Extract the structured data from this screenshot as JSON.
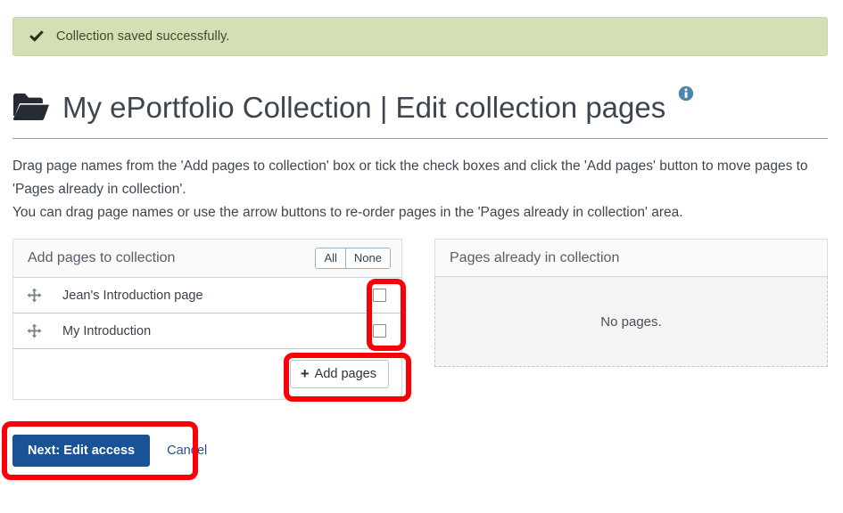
{
  "banner": {
    "icon": "check-icon",
    "message": "Collection saved successfully."
  },
  "header": {
    "icon": "folder-open-icon",
    "title": "My ePortfolio Collection | Edit collection pages",
    "info_icon": "info-circle-icon"
  },
  "instructions": {
    "line1": "Drag page names from the 'Add pages to collection' box or tick the check boxes and click the 'Add pages' button to move pages to 'Pages already in collection'.",
    "line2": "You can drag page names or use the arrow buttons to re-order pages in the 'Pages already in collection' area."
  },
  "add_panel": {
    "heading": "Add pages to collection",
    "select_all_label": "All",
    "select_none_label": "None",
    "rows": [
      {
        "handle_icon": "move-arrows-icon",
        "name": "Jean's Introduction page",
        "checked": false
      },
      {
        "handle_icon": "move-arrows-icon",
        "name": "My Introduction",
        "checked": false
      }
    ],
    "add_button": {
      "plus": "+",
      "label": "Add pages"
    }
  },
  "collection_panel": {
    "heading": "Pages already in collection",
    "empty_text": "No pages."
  },
  "actions": {
    "primary_label": "Next: Edit access",
    "cancel_label": "Cancel"
  },
  "colors": {
    "banner_bg": "#d3e0b5",
    "primary_button": "#1a5296",
    "link": "#1f4f9e",
    "highlight": "#fb0007",
    "info_icon": "#4a87ad",
    "title_rule": "#8ba6bd"
  },
  "highlights": [
    {
      "name": "checkbox-column-highlight"
    },
    {
      "name": "add-pages-button-highlight"
    },
    {
      "name": "bottom-actions-highlight"
    }
  ]
}
